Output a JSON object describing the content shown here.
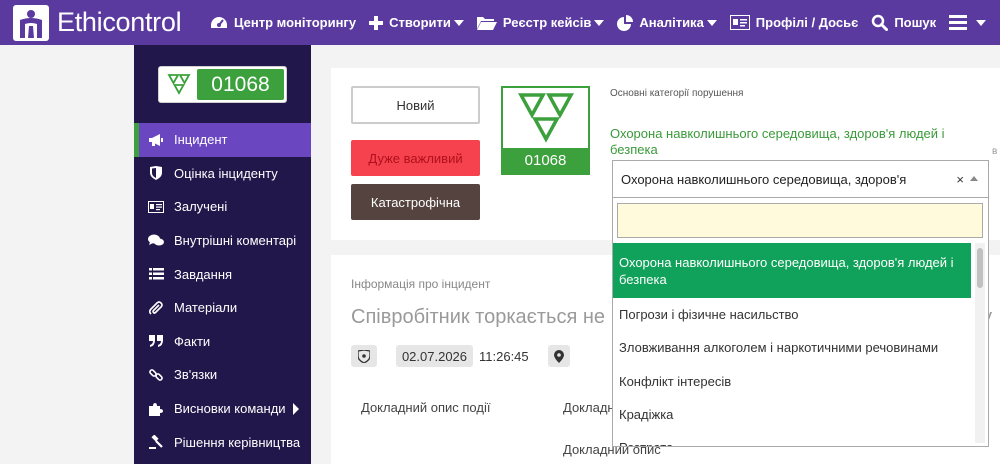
{
  "app": {
    "brand": "Ethicontrol"
  },
  "nav": {
    "items": [
      {
        "label": "Центр моніторингу",
        "icon": "dashboard-icon",
        "dropdown": false
      },
      {
        "label": "Створити",
        "icon": "plus-icon",
        "dropdown": true
      },
      {
        "label": "Реєстр кейсів",
        "icon": "folder-icon",
        "dropdown": true
      },
      {
        "label": "Аналітика",
        "icon": "pie-chart-icon",
        "dropdown": true
      },
      {
        "label": "Профілі / Досьє",
        "icon": "id-card-icon",
        "dropdown": false
      },
      {
        "label": "Пошук",
        "icon": "search-icon",
        "dropdown": false
      }
    ]
  },
  "case": {
    "number": "01068"
  },
  "sidebar": {
    "items": [
      {
        "label": "Інцидент",
        "icon": "megaphone-icon",
        "active": true
      },
      {
        "label": "Оцінка інциденту",
        "icon": "shield-icon"
      },
      {
        "label": "Залучені",
        "icon": "id-card-icon"
      },
      {
        "label": "Внутрішні коментарі",
        "icon": "comments-icon"
      },
      {
        "label": "Завдання",
        "icon": "list-icon"
      },
      {
        "label": "Матеріали",
        "icon": "paperclip-icon"
      },
      {
        "label": "Факти",
        "icon": "quote-icon"
      },
      {
        "label": "Зв'язки",
        "icon": "link-icon"
      },
      {
        "label": "Висновки команди",
        "icon": "puzzle-icon",
        "submenu": true
      },
      {
        "label": "Рішення керівництва",
        "icon": "gavel-icon"
      }
    ]
  },
  "status_buttons": {
    "new": "Новий",
    "very_important": "Дуже важливий",
    "catastrophic": "Катастрофічна"
  },
  "category": {
    "label": "Основні категорії порушення",
    "selected_text": "Охорона навколишнього середовища, здоров'я людей і безпека",
    "select_value": "Охорона навколишнього середовища, здоров'я",
    "clear_symbol": "×",
    "side_letter": "в",
    "search_value": "",
    "options": [
      "Охорона навколишнього середовища, здоров'я людей і безпека",
      "Погрози і фізичне насильство",
      "Зловживання алкоголем і наркотичними речовинами",
      "Конфлікт інтересів",
      "Крадіжка",
      "Розтрата"
    ]
  },
  "incident": {
    "section_label": "Інформація про інцидент",
    "title": "Співробітник торкається не",
    "title_tail": "у",
    "date": "02.07.2026",
    "time": "11:26:45",
    "description_label": "Докладний опис події",
    "col2_label": "Докладн",
    "col2_label2": "Докладний опис"
  },
  "colors": {
    "topbar": "#5b3aa0",
    "sidebar": "#21174a",
    "active_item": "#6b46c1",
    "green": "#3ca03c",
    "option_selected": "#10a15a",
    "very_important": "#f5424e",
    "catastrophic": "#54433e"
  }
}
